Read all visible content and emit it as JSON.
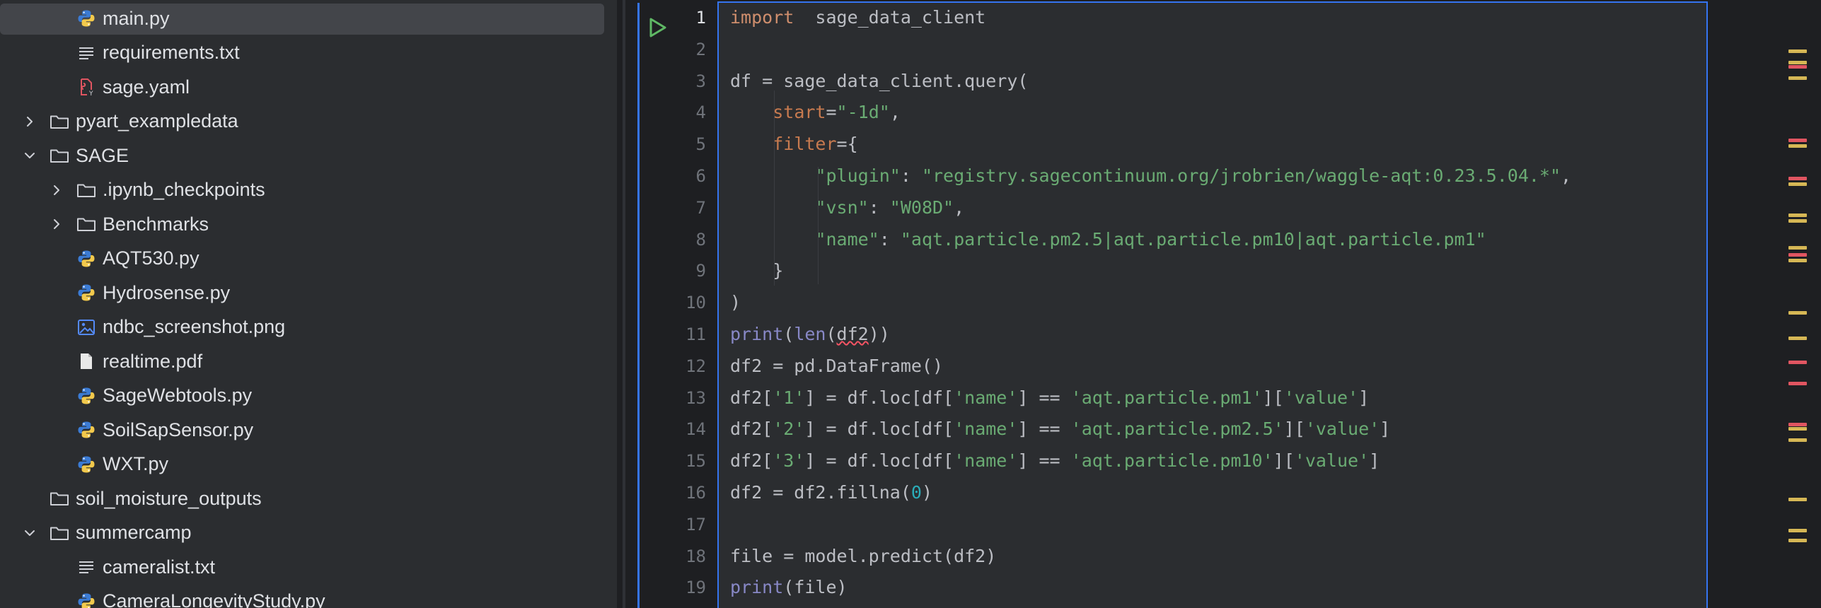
{
  "project_tree": {
    "items": [
      {
        "label": "main.py",
        "type": "python",
        "level": 2,
        "expand": "none",
        "selected": true
      },
      {
        "label": "requirements.txt",
        "type": "text",
        "level": 2,
        "expand": "none"
      },
      {
        "label": "sage.yaml",
        "type": "yaml",
        "level": 2,
        "expand": "none"
      },
      {
        "label": "pyart_exampledata",
        "type": "folder",
        "level": 1,
        "expand": "collapsed"
      },
      {
        "label": "SAGE",
        "type": "folder",
        "level": 1,
        "expand": "expanded"
      },
      {
        "label": ".ipynb_checkpoints",
        "type": "folder",
        "level": 2,
        "expand": "collapsed"
      },
      {
        "label": "Benchmarks",
        "type": "folder",
        "level": 2,
        "expand": "collapsed"
      },
      {
        "label": "AQT530.py",
        "type": "python",
        "level": 2,
        "expand": "none"
      },
      {
        "label": "Hydrosense.py",
        "type": "python",
        "level": 2,
        "expand": "none"
      },
      {
        "label": "ndbc_screenshot.png",
        "type": "image",
        "level": 2,
        "expand": "none"
      },
      {
        "label": "realtime.pdf",
        "type": "pdf",
        "level": 2,
        "expand": "none"
      },
      {
        "label": "SageWebtools.py",
        "type": "python",
        "level": 2,
        "expand": "none"
      },
      {
        "label": "SoilSapSensor.py",
        "type": "python",
        "level": 2,
        "expand": "none"
      },
      {
        "label": "WXT.py",
        "type": "python",
        "level": 2,
        "expand": "none"
      },
      {
        "label": "soil_moisture_outputs",
        "type": "folder",
        "level": 1,
        "expand": "none"
      },
      {
        "label": "summercamp",
        "type": "folder",
        "level": 1,
        "expand": "expanded"
      },
      {
        "label": "cameralist.txt",
        "type": "text",
        "level": 2,
        "expand": "none"
      },
      {
        "label": "CameraLongevityStudy.py",
        "type": "python",
        "level": 2,
        "expand": "none"
      }
    ]
  },
  "editor": {
    "current_line": 1,
    "lines": [
      {
        "n": "1",
        "tokens": [
          [
            "kw",
            "import"
          ],
          [
            "",
            "  sage_data_client"
          ]
        ]
      },
      {
        "n": "2",
        "tokens": []
      },
      {
        "n": "3",
        "tokens": [
          [
            "",
            "df = sage_data_client.query("
          ]
        ]
      },
      {
        "n": "4",
        "tokens": [
          [
            "",
            "    "
          ],
          [
            "param",
            "start"
          ],
          [
            "",
            "="
          ],
          [
            "str",
            "\"-1d\""
          ],
          [
            "",
            ","
          ]
        ]
      },
      {
        "n": "5",
        "tokens": [
          [
            "",
            "    "
          ],
          [
            "param",
            "filter"
          ],
          [
            "",
            "={"
          ]
        ]
      },
      {
        "n": "6",
        "tokens": [
          [
            "",
            "        "
          ],
          [
            "str",
            "\"plugin\""
          ],
          [
            "",
            ": "
          ],
          [
            "str",
            "\"registry.sagecontinuum.org/jrobrien/waggle-aqt:0.23.5.04.*\""
          ],
          [
            "",
            ","
          ]
        ]
      },
      {
        "n": "7",
        "tokens": [
          [
            "",
            "        "
          ],
          [
            "str",
            "\"vsn\""
          ],
          [
            "",
            ": "
          ],
          [
            "str",
            "\"W08D\""
          ],
          [
            "",
            ","
          ]
        ]
      },
      {
        "n": "8",
        "tokens": [
          [
            "",
            "        "
          ],
          [
            "str",
            "\"name\""
          ],
          [
            "",
            ": "
          ],
          [
            "str",
            "\"aqt.particle.pm2.5|aqt.particle.pm10|aqt.particle.pm1\""
          ]
        ]
      },
      {
        "n": "9",
        "tokens": [
          [
            "",
            "    }"
          ]
        ]
      },
      {
        "n": "10",
        "tokens": [
          [
            "",
            ")"
          ]
        ]
      },
      {
        "n": "11",
        "tokens": [
          [
            "bi",
            "print"
          ],
          [
            "",
            "("
          ],
          [
            "bi",
            "len"
          ],
          [
            "",
            "("
          ],
          [
            "err",
            "df2"
          ],
          [
            "",
            "))"
          ]
        ]
      },
      {
        "n": "12",
        "tokens": [
          [
            "",
            "df2 = pd.DataFrame()"
          ]
        ]
      },
      {
        "n": "13",
        "tokens": [
          [
            "",
            "df2["
          ],
          [
            "str",
            "'1'"
          ],
          [
            "",
            "] = df.loc[df["
          ],
          [
            "str",
            "'name'"
          ],
          [
            "",
            "] == "
          ],
          [
            "str",
            "'aqt.particle.pm1'"
          ],
          [
            "",
            "]["
          ],
          [
            "str",
            "'value'"
          ],
          [
            "",
            "]"
          ]
        ]
      },
      {
        "n": "14",
        "tokens": [
          [
            "",
            "df2["
          ],
          [
            "str",
            "'2'"
          ],
          [
            "",
            "] = df.loc[df["
          ],
          [
            "str",
            "'name'"
          ],
          [
            "",
            "] == "
          ],
          [
            "str",
            "'aqt.particle.pm2.5'"
          ],
          [
            "",
            "]["
          ],
          [
            "str",
            "'value'"
          ],
          [
            "",
            "]"
          ]
        ]
      },
      {
        "n": "15",
        "tokens": [
          [
            "",
            "df2["
          ],
          [
            "str",
            "'3'"
          ],
          [
            "",
            "] = df.loc[df["
          ],
          [
            "str",
            "'name'"
          ],
          [
            "",
            "] == "
          ],
          [
            "str",
            "'aqt.particle.pm10'"
          ],
          [
            "",
            "]["
          ],
          [
            "str",
            "'value'"
          ],
          [
            "",
            "]"
          ]
        ]
      },
      {
        "n": "16",
        "tokens": [
          [
            "",
            "df2 = df2.fillna("
          ],
          [
            "num",
            "0"
          ],
          [
            "",
            ")"
          ]
        ]
      },
      {
        "n": "17",
        "tokens": []
      },
      {
        "n": "18",
        "tokens": [
          [
            "",
            "file = model.predict(df2)"
          ]
        ]
      },
      {
        "n": "19",
        "tokens": [
          [
            "bi",
            "print"
          ],
          [
            "",
            "(file)"
          ]
        ]
      }
    ]
  },
  "colors": {
    "accent": "#3574f0",
    "run_icon": "#5fb865",
    "marker_warning": "#d6b755",
    "marker_error": "#e05561"
  },
  "error_stripe": {
    "markers": [
      "warning",
      "warning",
      "error",
      "warning",
      "error",
      "warning",
      "error",
      "warning",
      "warning",
      "warning",
      "warning",
      "error",
      "warning",
      "warning",
      "warning",
      "error",
      "error",
      "error",
      "warning",
      "warning",
      "warning",
      "warning",
      "warning"
    ]
  }
}
